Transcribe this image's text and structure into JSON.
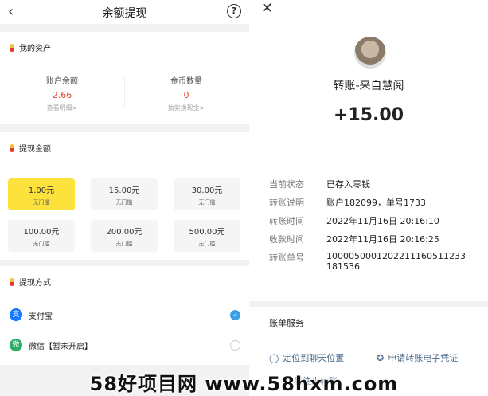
{
  "left": {
    "header": {
      "back_icon": "‹",
      "title": "余额提现",
      "help_icon": "?"
    },
    "assets": {
      "section_title": "我的资产",
      "balance": {
        "label": "账户余额",
        "value": "2.66",
        "link": "查看明细>"
      },
      "coins": {
        "label": "金币数量",
        "value": "0",
        "link": "抽奖换现金>"
      }
    },
    "withdraw": {
      "section_title": "提现金额",
      "amounts": [
        {
          "value": "1.00元",
          "sub": "无门槛",
          "selected": true
        },
        {
          "value": "15.00元",
          "sub": "无门槛",
          "selected": false
        },
        {
          "value": "30.00元",
          "sub": "无门槛",
          "selected": false
        },
        {
          "value": "100.00元",
          "sub": "无门槛",
          "selected": false
        },
        {
          "value": "200.00元",
          "sub": "无门槛",
          "selected": false
        },
        {
          "value": "500.00元",
          "sub": "无门槛",
          "selected": false
        }
      ]
    },
    "method": {
      "section_title": "提现方式",
      "options": [
        {
          "label": "支付宝",
          "icon": "alipay-icon",
          "checked": true
        },
        {
          "label": "微信【暂未开启】",
          "icon": "wechat-icon",
          "checked": false
        }
      ]
    }
  },
  "right": {
    "close_icon": "✕",
    "from": "转账-来自慧阅",
    "amount": "+15.00",
    "details": [
      {
        "key": "当前状态",
        "value": "已存入零钱"
      },
      {
        "key": "转账说明",
        "value": "账户182099，单号1733"
      },
      {
        "key": "转账时间",
        "value": "2022年11月16日 20:16:10"
      },
      {
        "key": "收款时间",
        "value": "2022年11月16日 20:16:25"
      },
      {
        "key": "转账单号",
        "value": "1000050001202211160511233181536"
      }
    ],
    "services": {
      "title": "账单服务",
      "locate": "定位到聊天位置",
      "voucher": "申请转账电子凭证",
      "partial": "查看往来转账"
    }
  },
  "watermark": "58好项目网 www.58hxm.com",
  "colors": {
    "accent_yellow": "#fde23e",
    "value_red": "#e24a2b",
    "alipay_blue": "#1677ff",
    "wechat_green": "#2aae67"
  }
}
